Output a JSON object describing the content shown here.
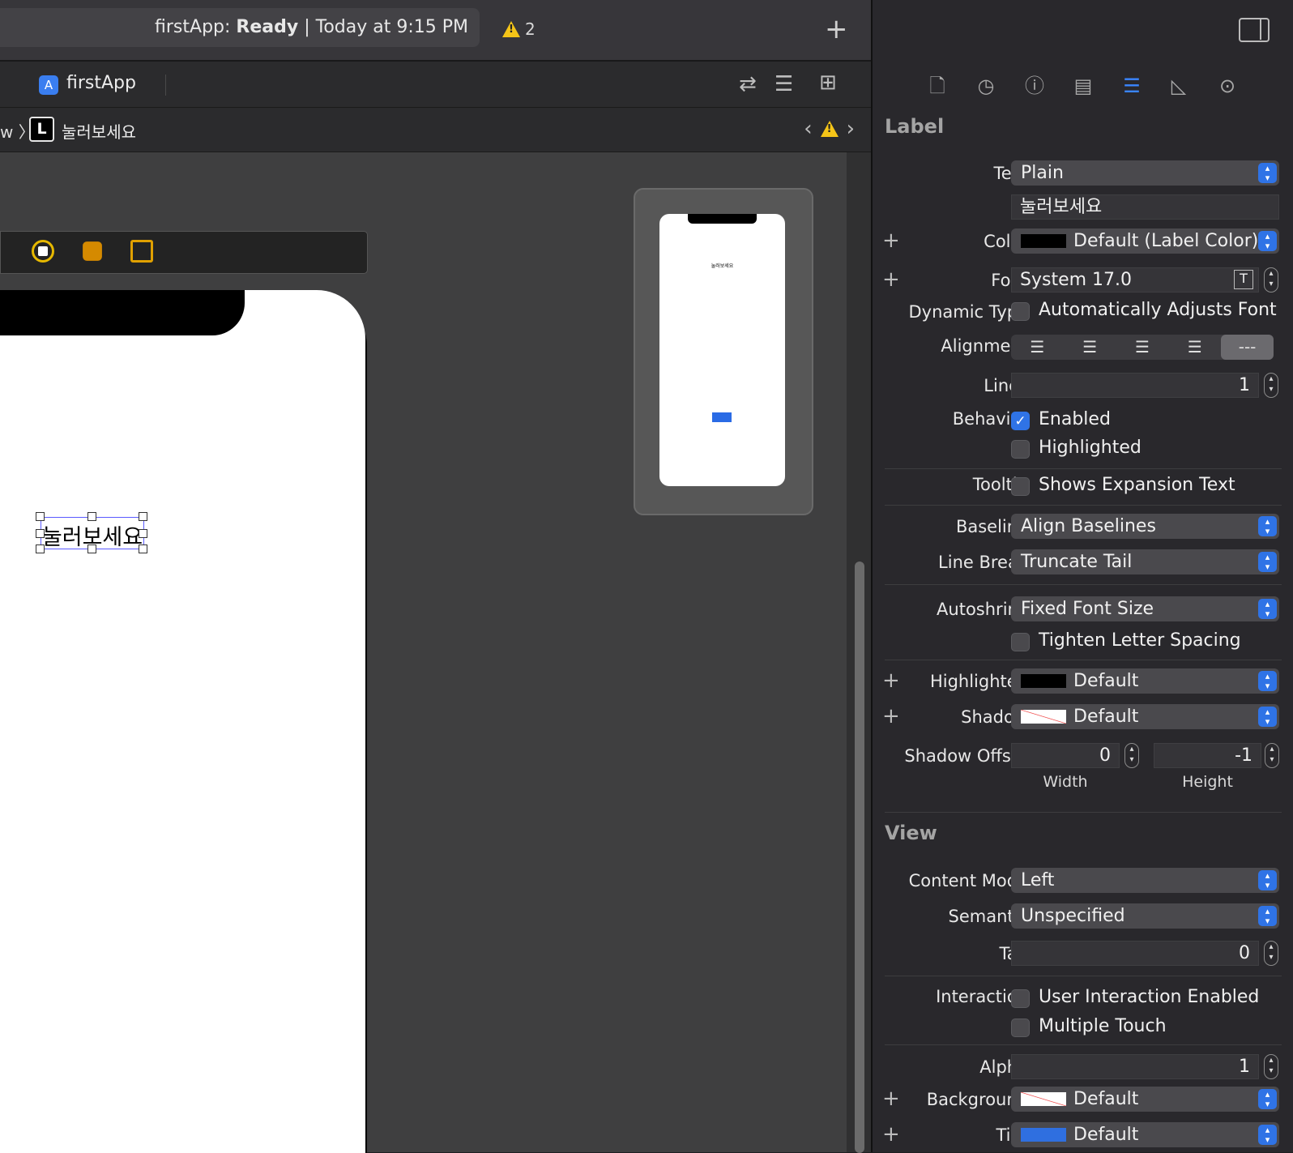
{
  "toolbar": {
    "status_app": "firstApp:",
    "status_state": "Ready",
    "status_time": "| Today at 9:15 PM",
    "warning_count": "2"
  },
  "tab": {
    "label": "firstApp"
  },
  "jumpbar": {
    "prev_fragment": "w",
    "badge": "L",
    "label": "눌러보세요"
  },
  "canvas": {
    "label_text": "눌러보세요",
    "thumb_label": "눌러보세요"
  },
  "inspector": {
    "label_section": "Label",
    "rows": {
      "text": {
        "label": "Text",
        "value": "Plain",
        "content": "눌러보세요"
      },
      "color": {
        "label": "Color",
        "value": "Default (Label Color)",
        "swatch": "#000000"
      },
      "font": {
        "label": "Font",
        "value": "System 17.0"
      },
      "dynamic_type": {
        "label": "Dynamic Type",
        "option": "Automatically Adjusts Font"
      },
      "alignment": {
        "label": "Alignment"
      },
      "lines": {
        "label": "Lines",
        "value": "1"
      },
      "behavior": {
        "label": "Behavior",
        "enabled": "Enabled",
        "highlighted": "Highlighted"
      },
      "tooltip": {
        "label": "Tooltip",
        "option": "Shows Expansion Text"
      },
      "baseline": {
        "label": "Baseline",
        "value": "Align Baselines"
      },
      "line_break": {
        "label": "Line Break",
        "value": "Truncate Tail"
      },
      "autoshrink": {
        "label": "Autoshrink",
        "value": "Fixed Font Size",
        "option": "Tighten Letter Spacing"
      },
      "highlighted": {
        "label": "Highlighted",
        "value": "Default",
        "swatch": "#000000"
      },
      "shadow": {
        "label": "Shadow",
        "value": "Default"
      },
      "shadow_offset": {
        "label": "Shadow Offset",
        "width": "0",
        "height": "-1",
        "width_label": "Width",
        "height_label": "Height"
      }
    },
    "view_section": "View",
    "view": {
      "content_mode": {
        "label": "Content Mode",
        "value": "Left"
      },
      "semantic": {
        "label": "Semantic",
        "value": "Unspecified"
      },
      "tag": {
        "label": "Tag",
        "value": "0"
      },
      "interaction": {
        "label": "Interaction",
        "user_enabled": "User Interaction Enabled",
        "multi_touch": "Multiple Touch"
      },
      "alpha": {
        "label": "Alpha",
        "value": "1"
      },
      "background": {
        "label": "Background",
        "value": "Default"
      },
      "tint": {
        "label": "Tint",
        "value": "Default",
        "swatch": "#2f6fe0"
      }
    }
  },
  "colors": {
    "accent": "#3a86ff",
    "warning": "#f5c518"
  }
}
